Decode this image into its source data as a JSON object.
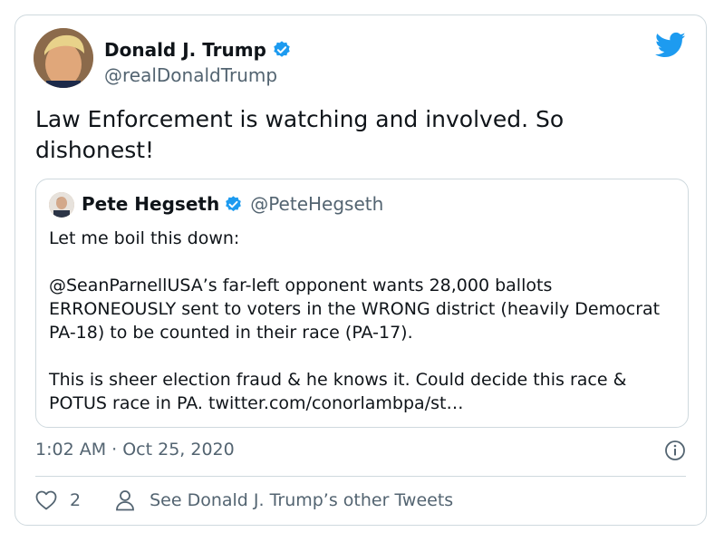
{
  "author": {
    "name": "Donald J. Trump",
    "handle": "@realDonaldTrump"
  },
  "tweet": {
    "text": "Law Enforcement is watching and involved. So dishonest!"
  },
  "quote": {
    "name": "Pete Hegseth",
    "handle": "@PeteHegseth",
    "text": "Let me boil this down:\n\n@SeanParnellUSA’s far-left opponent wants 28,000 ballots ERRONEOUSLY sent to voters in the WRONG district (heavily Democrat PA-18) to be counted in their race (PA-17).\n\nThis is sheer election fraud & he knows it. Could decide this race & POTUS race in PA. twitter.com/conorlambpa/st…"
  },
  "meta": {
    "timestamp": "1:02 AM · Oct 25, 2020",
    "likes": "2",
    "other_tweets_label": "See Donald J. Trump’s other Tweets"
  },
  "icons": {
    "verified": "verified-badge-icon",
    "bird": "twitter-bird-icon",
    "info": "info-icon",
    "like": "heart-icon",
    "profile": "person-icon"
  },
  "colors": {
    "brand": "#1d9bf0",
    "text": "#0f1419",
    "secondary": "#536471",
    "border": "#cfd9de"
  }
}
